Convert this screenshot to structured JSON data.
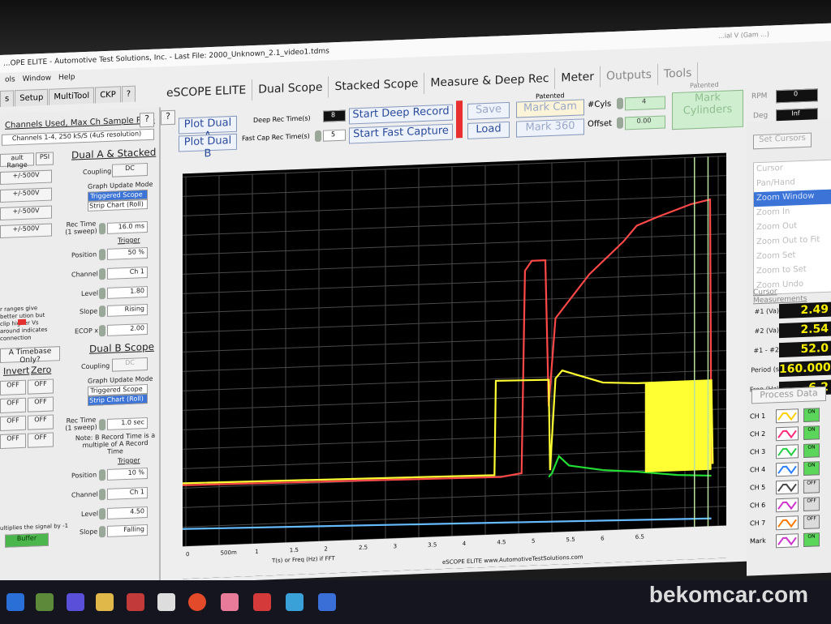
{
  "window": {
    "title": "...OPE ELITE - Automotive Test Solutions, Inc. - Last File: 2000_Unknown_2.1_video1.tdms",
    "right_title": "...ial V (Gam ...)"
  },
  "menu": [
    "ols",
    "Window",
    "Help"
  ],
  "left_tabs": [
    "s",
    "Setup",
    "MultiTool",
    "CKP",
    "?"
  ],
  "main_tabs": [
    {
      "label": "eSCOPE ELITE",
      "dim": false
    },
    {
      "label": "Dual Scope",
      "dim": false
    },
    {
      "label": "Stacked Scope",
      "dim": false
    },
    {
      "label": "Measure & Deep Rec",
      "dim": false
    },
    {
      "label": "Meter",
      "dim": false
    },
    {
      "label": "Outputs",
      "dim": true
    },
    {
      "label": "Tools",
      "dim": true
    }
  ],
  "left": {
    "channels_used": "Channels Used, Max Ch Sample Rate",
    "channels_info": "Channels 1-4, 250 kS/S (4uS resolution)",
    "help": "?",
    "fault_range": "ault Range",
    "psi": "PSI",
    "dual_a_title": "Dual A & Stacked",
    "ranges": [
      "+/-500V",
      "+/-500V",
      "+/-500V",
      "+/-500V"
    ],
    "coupling_label": "Coupling",
    "coupling_value": "DC",
    "graph_update_mode": "Graph Update Mode",
    "triggered_scope": "Triggered Scope",
    "strip_chart": "Strip Chart (Roll)",
    "rec_time_label": "Rec Time (1 sweep)",
    "rec_time_value": "16.0 ms",
    "trigger_label": "Trigger",
    "position_label": "Position",
    "position_value": "50 %",
    "channel_label": "Channel",
    "channel_value": "Ch 1",
    "level_label": "Level",
    "level_value": "1.80",
    "slope_label": "Slope",
    "slope_value": "Rising",
    "ecop_label": "ECOP x",
    "ecop_value": "2.00",
    "note_text": "r ranges give better ution but clip higher Vs around    indicates connection",
    "timebase_btn": "A Timebase Only?",
    "invert": "Invert",
    "zero": "Zero",
    "off": "OFF",
    "dual_b_title": "Dual B Scope",
    "coupling_b": "Coupling",
    "coupling_b_value": "DC",
    "graph_update_mode_b": "Graph Update Mode",
    "triggered_scope_b": "Triggered Scope",
    "strip_chart_b": "Strip Chart (Roll)",
    "rec_time_b_label": "Rec Time (1 sweep)",
    "rec_time_b_value": "1.0 sec",
    "note_b": "Note: B Record Time is a multiple of A Record Time",
    "trigger_b": "Trigger",
    "position_b_value": "10 %",
    "channel_b_value": "Ch 1",
    "level_b_value": "4.50",
    "slope_b_value": "Falling",
    "footer_note": "ultiplies the signal by -1",
    "buffer_btn": "Buffer"
  },
  "toolbar": {
    "help": "?",
    "plot_dual_a": "Plot Dual A",
    "plot_dual_b": "Plot Dual B",
    "deep_rec_label": "Deep Rec Time(s)",
    "deep_rec_value": "8",
    "fast_cap_label": "Fast Cap Rec Time(s)",
    "fast_cap_value": "5",
    "start_deep": "Start Deep Record",
    "start_fast": "Start Fast Capture",
    "save": "Save",
    "load": "Load",
    "patented1": "Patented",
    "mark_cam": "Mark Cam",
    "mark_360": "Mark 360",
    "cyls_label": "#Cyls",
    "cyls_value": "4",
    "offset_label": "Offset",
    "offset_value": "0.00",
    "patented2": "Patented",
    "mark_cylinders": "Mark Cylinders",
    "rpm_label": "RPM",
    "rpm_value": "0",
    "deg_label": "Deg",
    "deg_value": "Inf"
  },
  "right": {
    "set_cursors": "Set Cursors",
    "menu": [
      "Cursor",
      "Pan/Hand",
      "Zoom Window",
      "Zoom In",
      "Zoom Out",
      "Zoom Out to Fit",
      "Zoom Set",
      "Zoom to Set",
      "Zoom Undo"
    ],
    "cursor_meas": "Cursor Measurements",
    "readouts": [
      {
        "label": "#1 (Va)",
        "value": "2.49"
      },
      {
        "label": "#2 (Va)",
        "value": "2.54"
      },
      {
        "label": "#1 - #2",
        "value": "52.0"
      },
      {
        "label": "Period (s",
        "value": "160.000"
      },
      {
        "label": "Freq (Hz)",
        "value": "6.2"
      }
    ],
    "process_data": "Process Data",
    "channels": [
      {
        "label": "CH 1",
        "color": "#ffd000",
        "on": true
      },
      {
        "label": "CH 2",
        "color": "#ff2a7a",
        "on": true
      },
      {
        "label": "CH 3",
        "color": "#22cc44",
        "on": true
      },
      {
        "label": "CH 4",
        "color": "#2a7dff",
        "on": true
      },
      {
        "label": "CH 5",
        "color": "#444444",
        "on": false
      },
      {
        "label": "CH 6",
        "color": "#cc33cc",
        "on": false
      },
      {
        "label": "CH 7",
        "color": "#ff7a00",
        "on": false
      },
      {
        "label": "Mark",
        "color": "#cc33cc",
        "on": true
      }
    ],
    "on_label": "ON",
    "off_label": "OFF"
  },
  "chart_data": {
    "type": "line",
    "xlabel": "T(s) or Freq (Hz) if FFT",
    "footer": "eSCOPE ELITE  www.AutomotiveTestSolutions.com",
    "xlim": [
      0,
      7.9
    ],
    "ylim": [
      -3,
      16
    ],
    "x_ticks": [
      "0",
      "500m",
      "1",
      "1.5",
      "2",
      "2.5",
      "3",
      "3.5",
      "4",
      "4.5",
      "5",
      "5.5",
      "6",
      "6.5"
    ],
    "y_ticks": [
      -3,
      -2,
      -1,
      0,
      1,
      2,
      3,
      4,
      5,
      6,
      7,
      8,
      9,
      10,
      11,
      12,
      13,
      14,
      15,
      16
    ],
    "grid": true,
    "series": [
      {
        "color": "#ff4848",
        "points": [
          [
            0,
            0.15
          ],
          [
            4.6,
            -0.05
          ],
          [
            4.7,
            -0.05
          ],
          [
            5.0,
            0.1
          ],
          [
            5.05,
            10.5
          ],
          [
            5.15,
            11.0
          ],
          [
            5.35,
            11.0
          ],
          [
            5.4,
            3.5
          ],
          [
            5.5,
            8.0
          ],
          [
            6.0,
            10.2
          ],
          [
            6.5,
            11.8
          ],
          [
            6.7,
            12.6
          ],
          [
            7.0,
            13.0
          ],
          [
            7.5,
            13.6
          ],
          [
            7.78,
            13.8
          ],
          [
            7.8,
            0.2
          ]
        ]
      },
      {
        "color": "#ffff33",
        "points": [
          [
            0,
            0.25
          ],
          [
            4.6,
            0.05
          ],
          [
            4.62,
            4.9
          ],
          [
            5.4,
            4.85
          ],
          [
            5.42,
            0.2
          ],
          [
            5.5,
            4.9
          ],
          [
            5.6,
            5.3
          ],
          [
            6.2,
            4.6
          ],
          [
            6.7,
            4.5
          ],
          [
            7.8,
            4.5
          ],
          [
            7.82,
            0.2
          ]
        ]
      },
      {
        "color": "#22dd33",
        "points": [
          [
            5.4,
            -0.15
          ],
          [
            5.45,
            0.05
          ],
          [
            5.55,
            0.9
          ],
          [
            5.7,
            0.4
          ],
          [
            6.2,
            0.1
          ],
          [
            6.7,
            -0.05
          ],
          [
            7.3,
            -0.3
          ],
          [
            7.8,
            -0.4
          ]
        ]
      },
      {
        "color": "#66bbff",
        "points": [
          [
            0,
            -2.1
          ],
          [
            7.8,
            -2.6
          ]
        ]
      }
    ],
    "cursor_lines_x": [
      7.55,
      7.75
    ]
  }
}
